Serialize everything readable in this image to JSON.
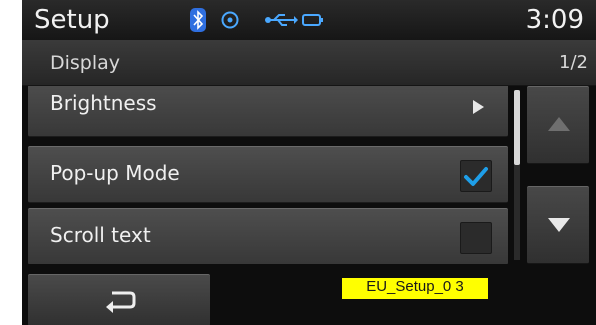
{
  "header": {
    "title": "Setup",
    "time": "3:09",
    "icons": [
      "bluetooth-icon",
      "disc-icon",
      "usb-icon",
      "battery-icon"
    ]
  },
  "subheader": {
    "title": "Display",
    "page": "1/2"
  },
  "list": {
    "items": [
      {
        "label": "Brightness",
        "control": "arrow"
      },
      {
        "label": "Pop-up Mode",
        "control": "checkbox",
        "checked": true
      },
      {
        "label": "Scroll text",
        "control": "checkbox",
        "checked": false
      }
    ]
  },
  "footer": {
    "tag_text": "EU_Setup_0 3"
  },
  "colors": {
    "check_color": "#1e9ee8",
    "tag_bg": "#ffff00"
  }
}
